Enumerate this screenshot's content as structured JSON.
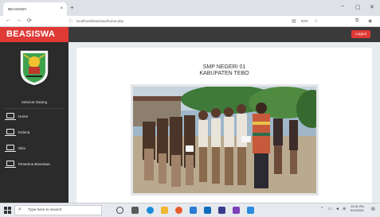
{
  "browser": {
    "tab_title": "BEASISWA",
    "tab_close": "×",
    "new_tab": "+",
    "window_controls": {
      "minimize": "−",
      "maximize": "▢",
      "close": "✕"
    },
    "nav": {
      "back": "←",
      "forward": "→",
      "reload": "⟳"
    },
    "url": "localhost/beasiswa/home.php",
    "zoom": "80%"
  },
  "app": {
    "brand": "BEASISWA",
    "logout_label": "Logout",
    "brand_color": "#e03a36",
    "sidebar": {
      "welcome": "Selamat Datang",
      "items": [
        {
          "label": "Home",
          "icon": "laptop-icon"
        },
        {
          "label": "Kriteria",
          "icon": "laptop-icon"
        },
        {
          "label": "Nilai",
          "icon": "laptop-icon"
        },
        {
          "label": "Penerima Beasiswa",
          "icon": "laptop-icon"
        }
      ]
    },
    "main": {
      "school_line1": "SMP NEGERI 01",
      "school_line2": "KABUPATEN TEBO"
    }
  },
  "taskbar": {
    "search_placeholder": "Type here to search",
    "time": "10:31 PM",
    "date": "9/13/2021"
  }
}
